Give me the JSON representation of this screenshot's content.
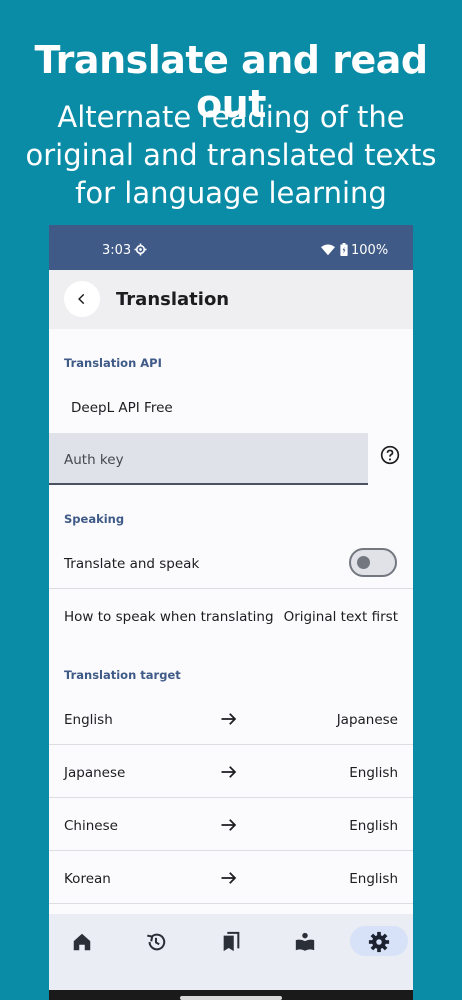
{
  "promo": {
    "title": "Translate and read out",
    "subtitle_lines": [
      "Alternate reading of the",
      "original and translated texts",
      "for language learning"
    ]
  },
  "status_bar": {
    "time": "3:03",
    "battery": "100%"
  },
  "app_bar": {
    "title": "Translation"
  },
  "translation_api": {
    "header": "Translation API",
    "selected": "DeepL API Free",
    "auth_placeholder": "Auth key"
  },
  "speaking": {
    "header": "Speaking",
    "translate_and_speak_label": "Translate and speak",
    "translate_and_speak_enabled": false,
    "how_to_speak_label": "How to speak when translating",
    "how_to_speak_value": "Original text first"
  },
  "translation_target": {
    "header": "Translation target",
    "rows": [
      {
        "from": "English",
        "to": "Japanese"
      },
      {
        "from": "Japanese",
        "to": "English"
      },
      {
        "from": "Chinese",
        "to": "English"
      },
      {
        "from": "Korean",
        "to": "English"
      }
    ]
  },
  "bottom_nav": {
    "items": [
      "home-icon",
      "history-icon",
      "bookmarks-icon",
      "reading-icon",
      "settings-icon"
    ],
    "active": "settings-icon"
  },
  "colors": {
    "background": "#0a8ba6",
    "status_bar": "#3f5a86",
    "section_header": "#3f5a86",
    "active_nav_pill": "#d7e2f8"
  }
}
